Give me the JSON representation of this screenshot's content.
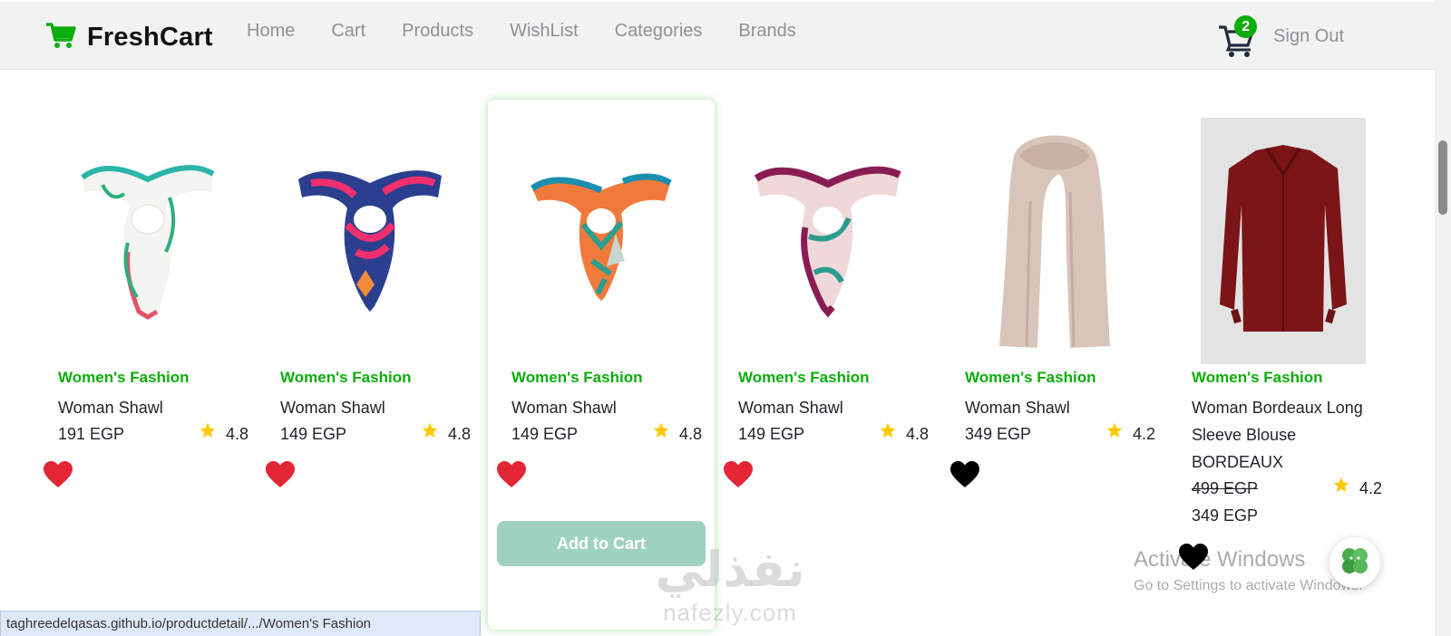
{
  "navbar": {
    "brand": "FreshCart",
    "links": [
      "Home",
      "Cart",
      "Products",
      "WishList",
      "Categories",
      "Brands"
    ],
    "cart_count": "2",
    "sign_out": "Sign Out"
  },
  "products": [
    {
      "category": "Women's Fashion",
      "title": "Woman Shawl",
      "price": "191 EGP",
      "rating": "4.8",
      "wishlisted": true,
      "image": "scarf-white-teal"
    },
    {
      "category": "Women's Fashion",
      "title": "Woman Shawl",
      "price": "149 EGP",
      "rating": "4.8",
      "wishlisted": true,
      "image": "scarf-pink-blue"
    },
    {
      "category": "Women's Fashion",
      "title": "Woman Shawl",
      "price": "149 EGP",
      "rating": "4.8",
      "wishlisted": true,
      "image": "scarf-orange-teal",
      "add_to_cart": "Add to Cart"
    },
    {
      "category": "Women's Fashion",
      "title": "Woman Shawl",
      "price": "149 EGP",
      "rating": "4.8",
      "wishlisted": true,
      "image": "scarf-magenta"
    },
    {
      "category": "Women's Fashion",
      "title": "Woman Shawl",
      "price": "349 EGP",
      "rating": "4.2",
      "wishlisted": false,
      "image": "scarf-beige"
    },
    {
      "category": "Women's Fashion",
      "title": "Woman Bordeaux Long Sleeve Blouse BORDEAUX",
      "old_price": "499 EGP",
      "price": "349 EGP",
      "rating": "4.2",
      "wishlisted": false,
      "image": "blouse-bordeaux"
    }
  ],
  "status_url": "taghreedelqasas.github.io/productdetail/.../Women's Fashion",
  "watermark": {
    "activate_title": "Activate Windows",
    "activate_sub": "Go to Settings to activate Windows.",
    "brand_ar": "نفذلي",
    "brand_en": "nafezly.com"
  },
  "colors": {
    "accent": "#0aad0a",
    "heart_active": "#e32636",
    "heart_inactive": "#000000",
    "button": "#9fd2bd"
  }
}
